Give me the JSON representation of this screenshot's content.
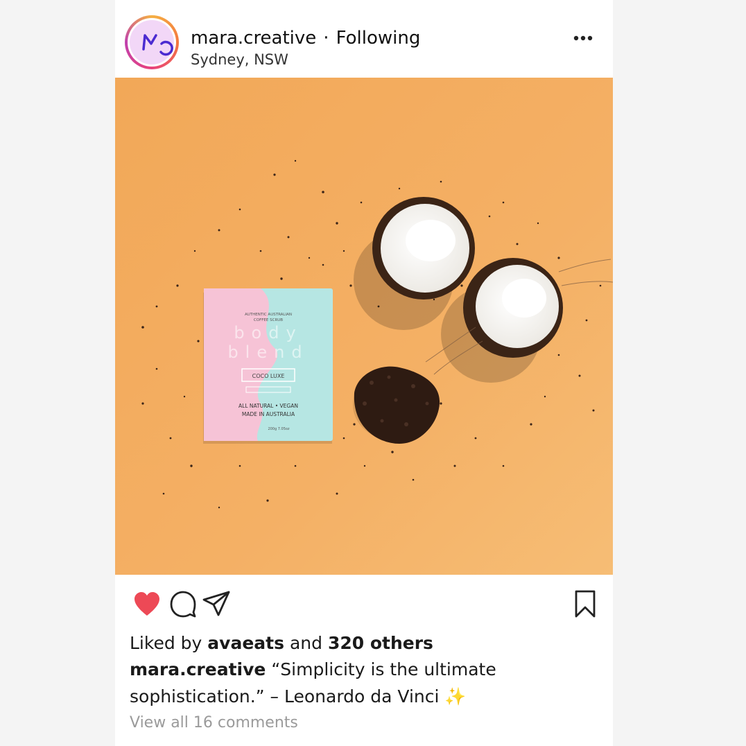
{
  "post": {
    "username": "mara.creative",
    "separator": "·",
    "follow_status": "Following",
    "location": "Sydney, NSW"
  },
  "product": {
    "line1": "AUTHENTIC AUSTRALIAN",
    "line2": "COFFEE SCRUB",
    "brand1": "body",
    "brand2": "blend",
    "flavor": "COCO LUXE",
    "tagline1": "ALL NATURAL • VEGAN",
    "tagline2": "MADE IN AUSTRALIA",
    "weight": "200g  7.05oz"
  },
  "likes": {
    "prefix": "Liked by",
    "user": "avaeats",
    "middle": "and",
    "count": "320 others"
  },
  "caption": {
    "user": "mara.creative",
    "text": "“Simplicity is the ultimate sophistication.” – Leonardo da Vinci",
    "emoji": "✨"
  },
  "comments_link": "View all 16 comments",
  "icons": {
    "like": "heart-icon",
    "comment": "comment-icon",
    "share": "send-icon",
    "save": "bookmark-icon",
    "more": "more-icon"
  },
  "colors": {
    "heart": "#ed4956",
    "photo_background": "#f3ad61",
    "avatar_logo": "#4b2bd1"
  }
}
